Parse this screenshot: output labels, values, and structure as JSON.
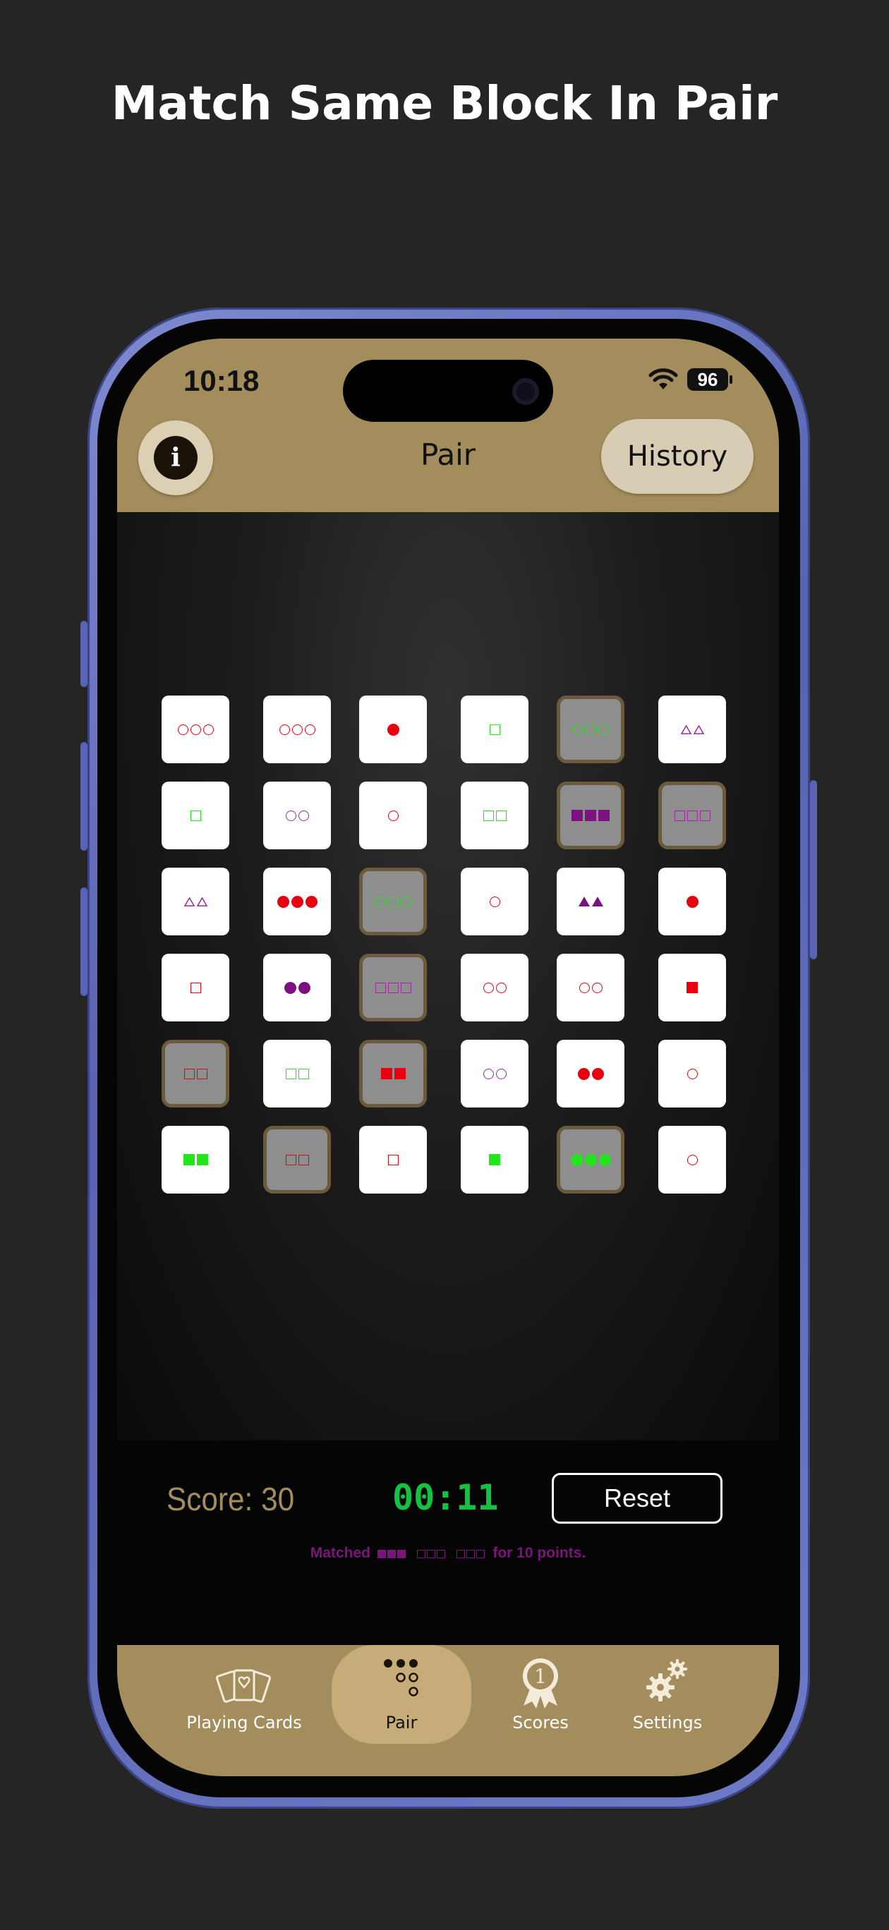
{
  "headline": "Match Same Block In Pair",
  "status_bar": {
    "time": "10:18",
    "battery": "96"
  },
  "nav": {
    "title": "Pair",
    "info_icon": "i",
    "history_label": "History"
  },
  "colors": {
    "red": "#e8000f",
    "green": "#22e51b",
    "purple": "#9b2a9b",
    "dark_purple": "#7c127f",
    "timer": "#15c140",
    "gold": "#a48d5c"
  },
  "board": {
    "rows": [
      [
        {
          "shape": "circle",
          "fill": "outline",
          "color": "#e8000f",
          "count": 3,
          "selected": false
        },
        {
          "shape": "circle",
          "fill": "outline",
          "color": "#e8000f",
          "count": 3,
          "selected": false
        },
        {
          "shape": "circle",
          "fill": "solid",
          "color": "#e8000f",
          "count": 1,
          "selected": false
        },
        {
          "shape": "square",
          "fill": "outline",
          "color": "#22e51b",
          "count": 1,
          "selected": false
        },
        {
          "shape": "circle",
          "fill": "outline",
          "color": "#22e51b",
          "count": 3,
          "selected": true
        },
        {
          "shape": "triangle",
          "fill": "outline",
          "color": "#9b2a9b",
          "count": 2,
          "selected": false
        }
      ],
      [
        {
          "shape": "square",
          "fill": "outline",
          "color": "#22e51b",
          "count": 1,
          "selected": false
        },
        {
          "shape": "circle",
          "fill": "outline",
          "color": "#9b2a9b",
          "count": 2,
          "selected": false
        },
        {
          "shape": "circle",
          "fill": "outline",
          "color": "#e8000f",
          "count": 1,
          "selected": false
        },
        {
          "shape": "square",
          "fill": "outline",
          "color": "#22e51b",
          "count": 2,
          "selected": false
        },
        {
          "shape": "square",
          "fill": "solid",
          "color": "#7c127f",
          "count": 3,
          "selected": true
        },
        {
          "shape": "square",
          "fill": "outline",
          "color": "#9b2a9b",
          "count": 3,
          "selected": true
        }
      ],
      [
        {
          "shape": "triangle",
          "fill": "outline",
          "color": "#9b2a9b",
          "count": 2,
          "selected": false
        },
        {
          "shape": "circle",
          "fill": "solid",
          "color": "#e8000f",
          "count": 3,
          "selected": false
        },
        {
          "shape": "circle",
          "fill": "outline",
          "color": "#22e51b",
          "count": 3,
          "selected": true
        },
        {
          "shape": "circle",
          "fill": "outline",
          "color": "#e8000f",
          "count": 1,
          "selected": false
        },
        {
          "shape": "triangle",
          "fill": "solid",
          "color": "#7c127f",
          "count": 2,
          "selected": false
        },
        {
          "shape": "circle",
          "fill": "solid",
          "color": "#e8000f",
          "count": 1,
          "selected": false
        }
      ],
      [
        {
          "shape": "square",
          "fill": "outline",
          "color": "#e8000f",
          "count": 1,
          "selected": false
        },
        {
          "shape": "circle",
          "fill": "solid",
          "color": "#7c127f",
          "count": 2,
          "selected": false
        },
        {
          "shape": "square",
          "fill": "outline",
          "color": "#9b2a9b",
          "count": 3,
          "selected": true
        },
        {
          "shape": "circle",
          "fill": "outline",
          "color": "#e8000f",
          "count": 2,
          "selected": false
        },
        {
          "shape": "circle",
          "fill": "outline",
          "color": "#e8000f",
          "count": 2,
          "selected": false
        },
        {
          "shape": "square",
          "fill": "solid",
          "color": "#e8000f",
          "count": 1,
          "selected": false
        }
      ],
      [
        {
          "shape": "square",
          "fill": "outline",
          "color": "#e8000f",
          "count": 2,
          "selected": true
        },
        {
          "shape": "square",
          "fill": "outline",
          "color": "#22e51b",
          "count": 2,
          "selected": false
        },
        {
          "shape": "square",
          "fill": "solid",
          "color": "#e8000f",
          "count": 2,
          "selected": true
        },
        {
          "shape": "circle",
          "fill": "outline",
          "color": "#9b2a9b",
          "count": 2,
          "selected": false
        },
        {
          "shape": "circle",
          "fill": "solid",
          "color": "#e8000f",
          "count": 2,
          "selected": false
        },
        {
          "shape": "circle",
          "fill": "outline",
          "color": "#e8000f",
          "count": 1,
          "selected": false
        }
      ],
      [
        {
          "shape": "square",
          "fill": "solid",
          "color": "#22e51b",
          "count": 2,
          "selected": false
        },
        {
          "shape": "square",
          "fill": "outline",
          "color": "#e8000f",
          "count": 2,
          "selected": true
        },
        {
          "shape": "square",
          "fill": "outline",
          "color": "#e8000f",
          "count": 1,
          "selected": false
        },
        {
          "shape": "square",
          "fill": "solid",
          "color": "#22e51b",
          "count": 1,
          "selected": false
        },
        {
          "shape": "circle",
          "fill": "solid",
          "color": "#22e51b",
          "count": 3,
          "selected": true
        },
        {
          "shape": "circle",
          "fill": "outline",
          "color": "#e8000f",
          "count": 1,
          "selected": false
        }
      ]
    ]
  },
  "footer": {
    "score": "Score: 30",
    "timer": "00:11",
    "reset_label": "Reset",
    "match_prefix": "Matched",
    "match_suffix": "for 10 points."
  },
  "tabs": [
    {
      "label": "Playing Cards",
      "icon": "playing-cards-icon",
      "active": false
    },
    {
      "label": "Pair",
      "icon": "dots-icon",
      "active": true
    },
    {
      "label": "Scores",
      "icon": "award-ribbon-icon",
      "active": false
    },
    {
      "label": "Settings",
      "icon": "gears-icon",
      "active": false
    }
  ]
}
